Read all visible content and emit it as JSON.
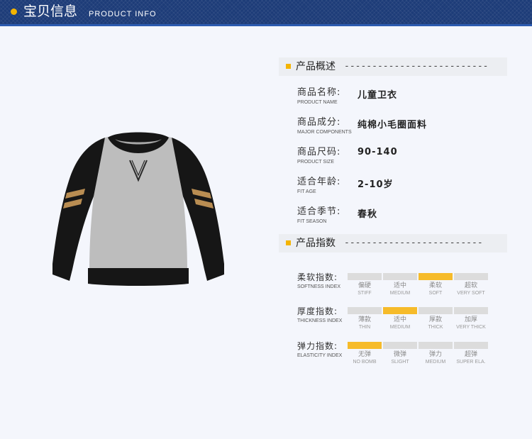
{
  "header": {
    "title": "宝贝信息",
    "subtitle": "PRODUCT INFO"
  },
  "overview": {
    "heading": "产品概述",
    "dashes": "--------------------------",
    "rows": [
      {
        "label": "商品名称:",
        "en": "PRODUCT NAME",
        "value": "儿童卫衣"
      },
      {
        "label": "商品成分:",
        "en": "MAJOR COMPONENTS",
        "value": "纯棉小毛圈面料"
      },
      {
        "label": "商品尺码:",
        "en": "PRODUCT SIZE",
        "value": "90-140"
      },
      {
        "label": "适合年龄:",
        "en": "FIT AGE",
        "value": "2-10岁"
      },
      {
        "label": "适合季节:",
        "en": "FIT SEASON",
        "value": "春秋"
      }
    ]
  },
  "indexes": {
    "heading": "产品指数",
    "dashes": "-------------------------",
    "items": [
      {
        "label": "柔软指数:",
        "en": "SOFTNESS INDEX",
        "selected": 2,
        "options": [
          {
            "cn": "偏硬",
            "en": "STIFF"
          },
          {
            "cn": "适中",
            "en": "MEDIUM"
          },
          {
            "cn": "柔软",
            "en": "SOFT"
          },
          {
            "cn": "超软",
            "en": "VERY SOFT"
          }
        ]
      },
      {
        "label": "厚度指数:",
        "en": "THICKNESS INDEX",
        "selected": 1,
        "options": [
          {
            "cn": "薄款",
            "en": "THIN"
          },
          {
            "cn": "适中",
            "en": "MEDIUM"
          },
          {
            "cn": "厚款",
            "en": "THICK"
          },
          {
            "cn": "加厚",
            "en": "VERY THICK"
          }
        ]
      },
      {
        "label": "弹力指数:",
        "en": "ELASTICITY INDEX",
        "selected": 0,
        "options": [
          {
            "cn": "无弹",
            "en": "NO BOMB"
          },
          {
            "cn": "微弹",
            "en": "SLIGHT"
          },
          {
            "cn": "弹力",
            "en": "MEDIUM"
          },
          {
            "cn": "超弹",
            "en": "SUPER ELA."
          }
        ]
      }
    ]
  },
  "colors": {
    "header_bg": "#1d3c78",
    "accent": "#f4b400",
    "index_on": "#f6bb2a",
    "index_off": "#dcdcdc"
  }
}
